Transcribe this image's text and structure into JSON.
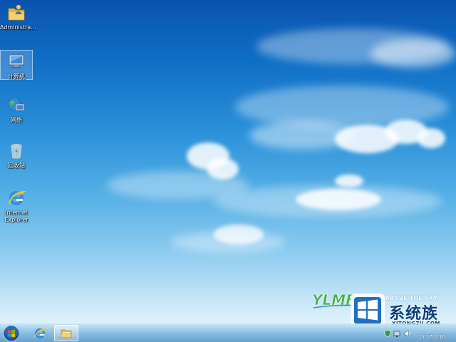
{
  "desktop": {
    "icons": [
      {
        "label": "Administra...",
        "icon": "user-folder-icon"
      },
      {
        "label": "计算机",
        "icon": "computer-icon"
      },
      {
        "label": "网络",
        "icon": "network-icon"
      },
      {
        "label": "回收站",
        "icon": "recycle-bin-icon"
      },
      {
        "label": "Internet Explorer",
        "icon": "internet-explorer-icon"
      }
    ]
  },
  "wallpaper": {
    "logo_text": "YLMF",
    "slogan": "FLY ABOVE THE SKY",
    "watermark_title": "系统族",
    "watermark_site": "XITONGZU.COM"
  },
  "taskbar": {
    "start": "start-orb-icon",
    "pinned": [
      {
        "icon": "internet-explorer-icon"
      },
      {
        "icon": "windows-explorer-icon"
      }
    ],
    "tray": {
      "date": "2017/2/16"
    }
  },
  "colors": {
    "sky_top": "#0a53ae",
    "sky_bottom": "#eaf6fc",
    "logo_green": "#46b04a",
    "logo_blue": "#2a8fd4",
    "watermark_blue": "#0b3f7a"
  }
}
